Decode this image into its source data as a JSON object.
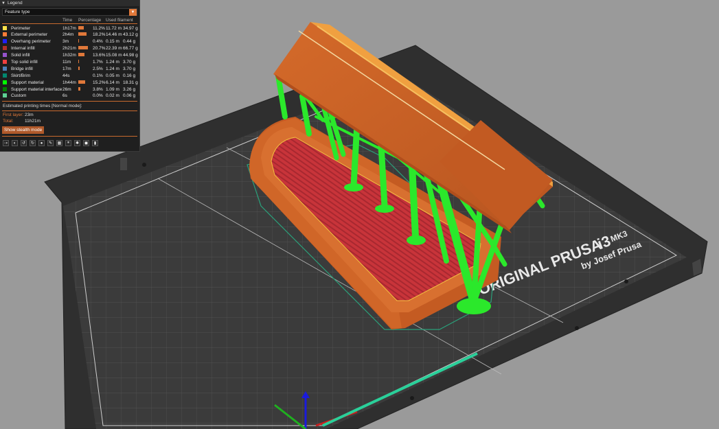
{
  "legend": {
    "title": "Legend",
    "view_type": "Feature type",
    "columns": {
      "time": "Time",
      "percentage": "Percentage",
      "filament": "Used filament"
    },
    "rows": [
      {
        "name": "Perimeter",
        "color": "#FFE24A",
        "time": "1h17m",
        "pct": "11.2%",
        "pct_value": 11.2,
        "length": "11.72 m",
        "weight": "34.97 g"
      },
      {
        "name": "External perimeter",
        "color": "#FF7D38",
        "time": "2h4m",
        "pct": "18.2%",
        "pct_value": 18.2,
        "length": "14.46 m",
        "weight": "43.12 g"
      },
      {
        "name": "Overhang perimeter",
        "color": "#1F1FFF",
        "time": "3m",
        "pct": "0.4%",
        "pct_value": 0.4,
        "length": "0.15 m",
        "weight": "0.44 g"
      },
      {
        "name": "Internal infill",
        "color": "#B03029",
        "time": "2h21m",
        "pct": "20.7%",
        "pct_value": 20.7,
        "length": "22.39 m",
        "weight": "66.77 g"
      },
      {
        "name": "Solid infill",
        "color": "#9654CC",
        "time": "1h32m",
        "pct": "13.6%",
        "pct_value": 13.6,
        "length": "15.08 m",
        "weight": "44.98 g"
      },
      {
        "name": "Top solid infill",
        "color": "#F04040",
        "time": "11m",
        "pct": "1.7%",
        "pct_value": 1.7,
        "length": "1.24 m",
        "weight": "3.70 g"
      },
      {
        "name": "Bridge infill",
        "color": "#4D80BA",
        "time": "17m",
        "pct": "2.5%",
        "pct_value": 2.5,
        "length": "1.24 m",
        "weight": "3.70 g"
      },
      {
        "name": "Skirt/Brim",
        "color": "#00876E",
        "time": "44s",
        "pct": "0.1%",
        "pct_value": 0.1,
        "length": "0.05 m",
        "weight": "0.16 g"
      },
      {
        "name": "Support material",
        "color": "#00FF00",
        "time": "1h44m",
        "pct": "15.2%",
        "pct_value": 15.2,
        "length": "6.14 m",
        "weight": "18.31 g"
      },
      {
        "name": "Support material interface",
        "color": "#008000",
        "time": "26m",
        "pct": "3.8%",
        "pct_value": 3.8,
        "length": "1.09 m",
        "weight": "3.26 g"
      },
      {
        "name": "Custom",
        "color": "#5ED194",
        "time": "6s",
        "pct": "0.0%",
        "pct_value": 0.0,
        "length": "0.02 m",
        "weight": "0.06 g"
      }
    ],
    "estimated_title": "Estimated printing times [Normal mode]:",
    "first_layer_label": "First layer:",
    "first_layer_value": "23m",
    "total_label": "Total:",
    "total_value": "11h21m",
    "stealth_button": "Show stealth mode",
    "view_icons": [
      "travel-icon",
      "wipe-icon",
      "retractions-icon",
      "deretractions-icon",
      "seams-icon",
      "tool-changes-icon",
      "color-changes-icon",
      "pause-prints-icon",
      "custom-gcodes-icon",
      "shells-icon",
      "tool-marker-icon"
    ]
  },
  "bed": {
    "brand_line1": "ORIGINAL PRUSA",
    "brand_model": "i3",
    "brand_variant": "MK3",
    "brand_line2": "by Josef Prusa"
  },
  "colors": {
    "accent": "#E0783A",
    "background": "#9A9A9A",
    "panel": "#1F1F1F"
  }
}
